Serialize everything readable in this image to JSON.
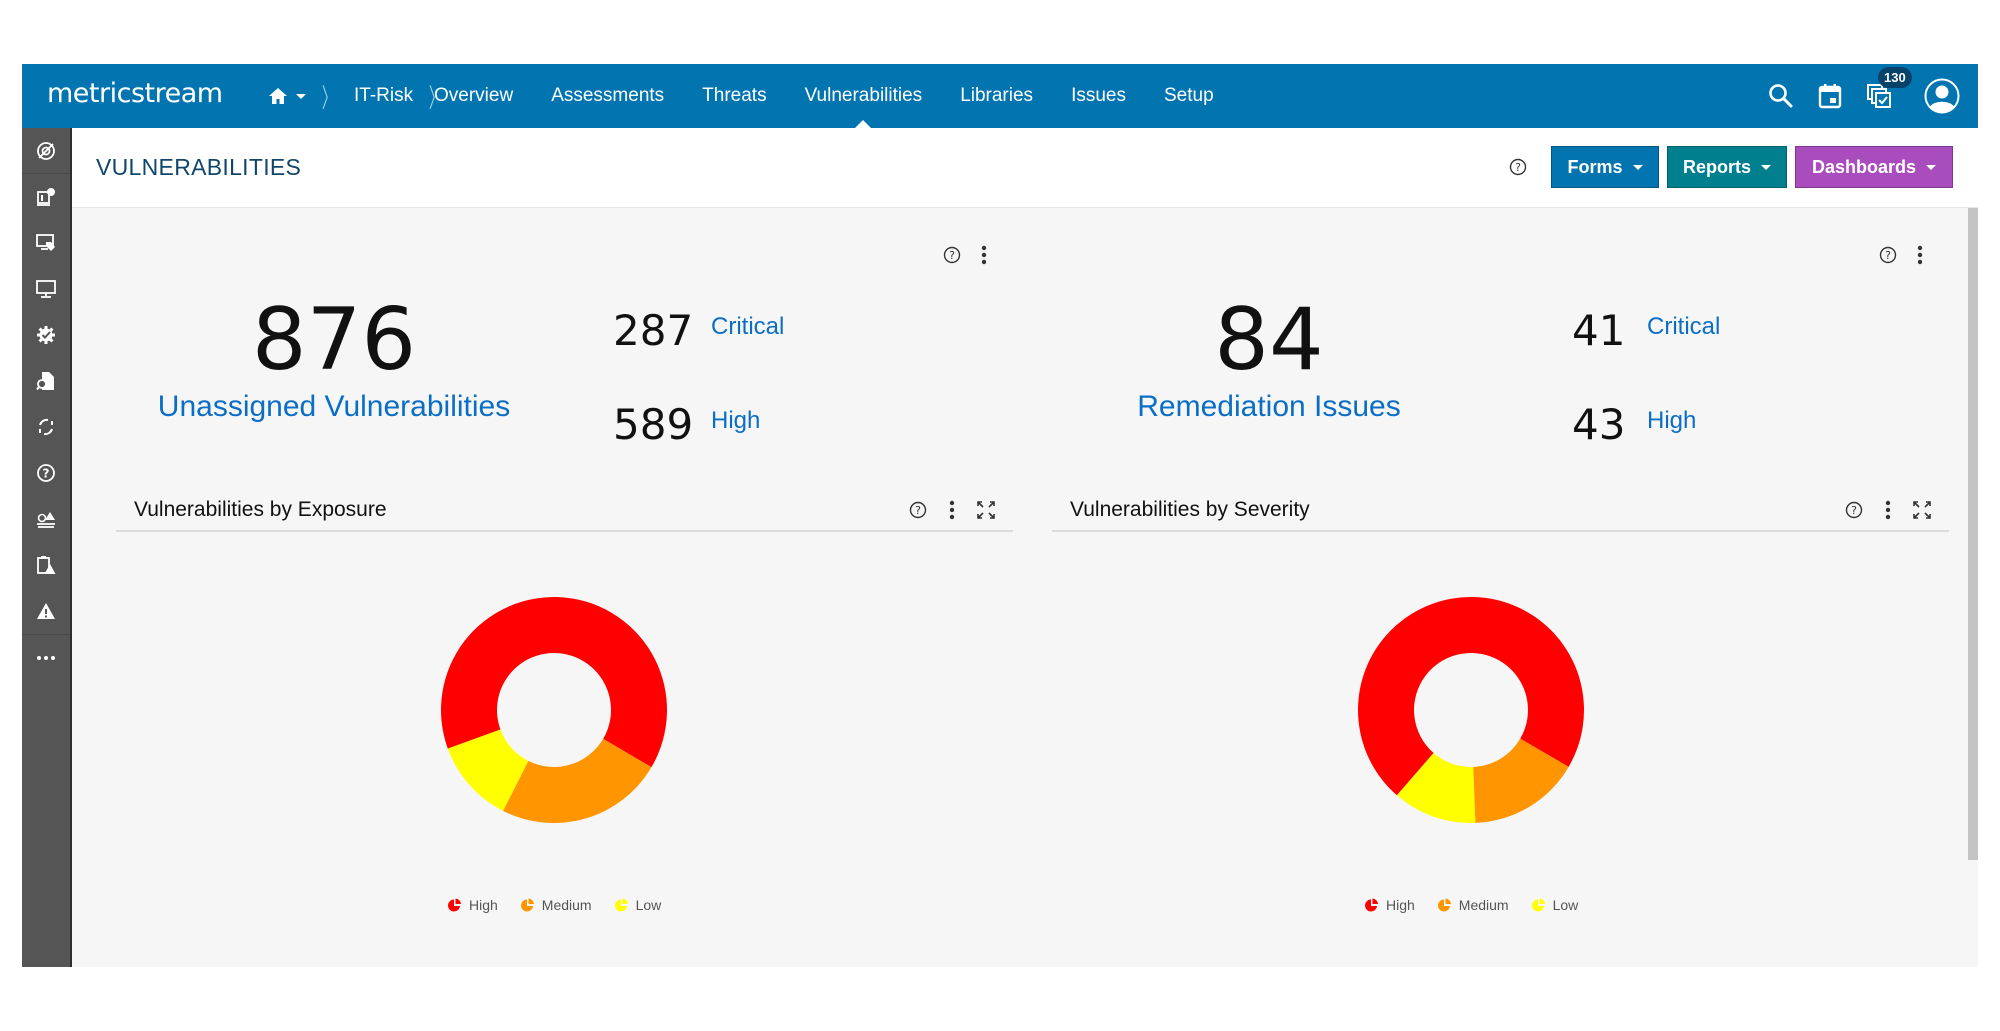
{
  "app": {
    "logo": "metricstream",
    "breadcrumb": [
      {
        "label": "home",
        "icon": "home-icon"
      },
      {
        "label": "IT-Risk"
      }
    ],
    "nav": [
      {
        "label": "Overview",
        "active": false
      },
      {
        "label": "Assessments",
        "active": false
      },
      {
        "label": "Threats",
        "active": false
      },
      {
        "label": "Vulnerabilities",
        "active": true
      },
      {
        "label": "Libraries",
        "active": false
      },
      {
        "label": "Issues",
        "active": false
      },
      {
        "label": "Setup",
        "active": false
      }
    ],
    "header_icons": [
      "search-icon",
      "calendar-icon",
      "tasks-icon",
      "user-avatar-icon"
    ],
    "tasks_badge": "130",
    "colors": {
      "nav": "#0275b1",
      "sidebar": "#555555",
      "link": "#0b6ec6",
      "title": "#10466b"
    }
  },
  "sidebar": {
    "items": [
      {
        "icon": "risk-target-icon"
      },
      {
        "icon": "compliance-doc-icon"
      },
      {
        "icon": "asset-tag-icon"
      },
      {
        "icon": "monitor-icon"
      },
      {
        "icon": "gear-check-icon"
      },
      {
        "icon": "document-search-icon"
      },
      {
        "icon": "refresh-cycle-icon"
      },
      {
        "icon": "help-circle-icon"
      },
      {
        "icon": "risk-alert-icon"
      },
      {
        "icon": "clipboard-warning-icon"
      },
      {
        "icon": "warning-icon"
      },
      {
        "icon": "more-icon"
      }
    ]
  },
  "page": {
    "title": "VULNERABILITIES",
    "buttons": {
      "forms": {
        "label": "Forms",
        "color": "#0275b1"
      },
      "reports": {
        "label": "Reports",
        "color": "#00808f"
      },
      "dashboards": {
        "label": "Dashboards",
        "color": "#a94cbd"
      }
    }
  },
  "kpis": [
    {
      "value": "876",
      "label": "Unassigned Vulnerabilities",
      "breakdown": [
        {
          "value": "287",
          "label": "Critical"
        },
        {
          "value": "589",
          "label": "High"
        }
      ]
    },
    {
      "value": "84",
      "label": "Remediation Issues",
      "breakdown": [
        {
          "value": "41",
          "label": "Critical"
        },
        {
          "value": "43",
          "label": "High"
        }
      ]
    }
  ],
  "chart_data": [
    {
      "type": "pie",
      "variant": "donut",
      "title": "Vulnerabilities by Exposure",
      "categories": [
        "High",
        "Medium",
        "Low"
      ],
      "values_percent": [
        64,
        24,
        12
      ],
      "colors": [
        "#ff0000",
        "#ff9500",
        "#ffff00"
      ],
      "legend": "bottom"
    },
    {
      "type": "pie",
      "variant": "donut",
      "title": "Vulnerabilities by Severity",
      "categories": [
        "High",
        "Medium",
        "Low"
      ],
      "values_percent": [
        72,
        16,
        12
      ],
      "colors": [
        "#ff0000",
        "#ff9500",
        "#ffff00"
      ],
      "legend": "bottom"
    }
  ]
}
